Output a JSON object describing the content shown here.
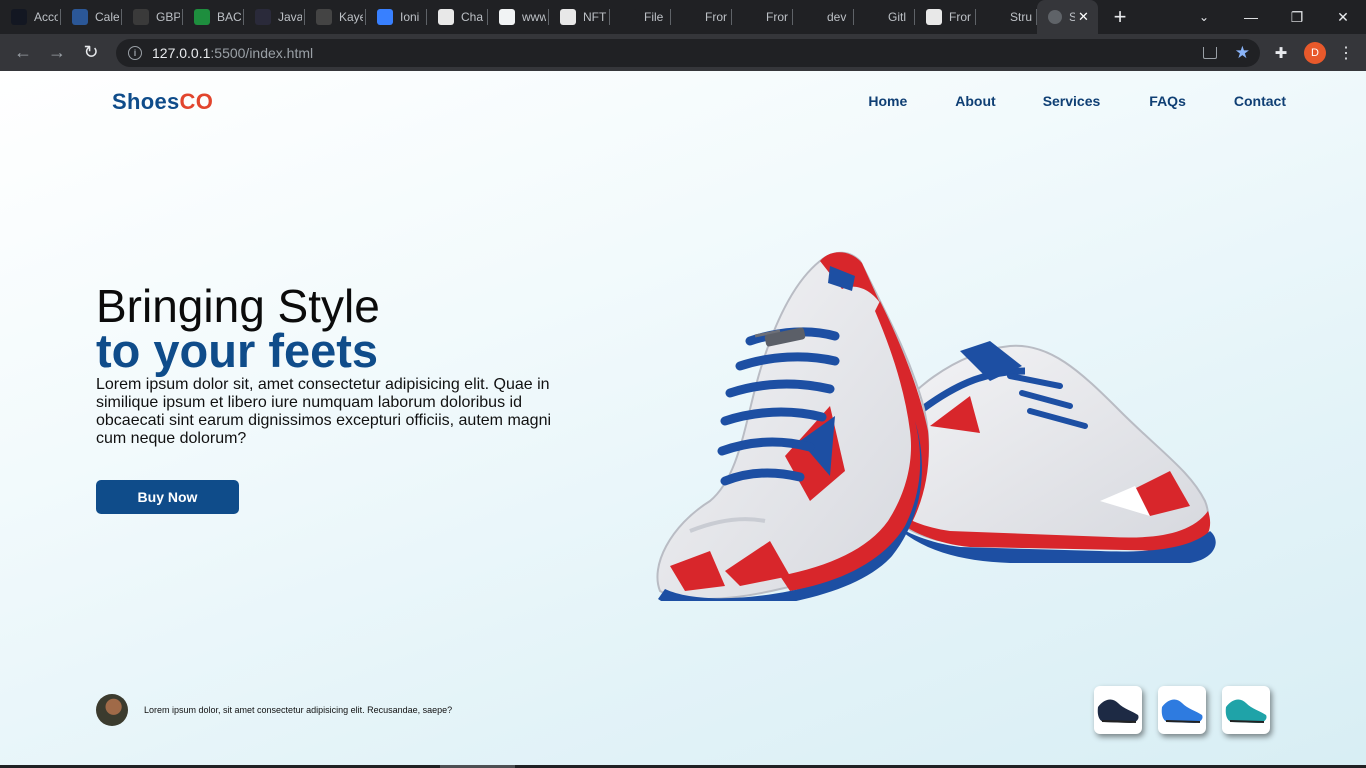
{
  "browser": {
    "tabs": [
      {
        "title": "Acco",
        "icon": "trading-icon",
        "color": "#131722"
      },
      {
        "title": "Cale",
        "icon": "calendar-icon",
        "color": "#2b5797"
      },
      {
        "title": "GBP",
        "icon": "function-icon",
        "color": "#3a3a3a"
      },
      {
        "title": "BAC",
        "icon": "sheets-icon",
        "color": "#1e8e3e"
      },
      {
        "title": "Java",
        "icon": "javascript-icon",
        "color": "#2a2a3a"
      },
      {
        "title": "Kaye",
        "icon": "qr-icon",
        "color": "#444"
      },
      {
        "title": "Ioni",
        "icon": "ionic-icon",
        "color": "#3880ff"
      },
      {
        "title": "Cha",
        "icon": "chat-icon",
        "color": "#e8e8e8"
      },
      {
        "title": "www",
        "icon": "doc-icon",
        "color": "#f1f3f4"
      },
      {
        "title": "NFT",
        "icon": "nft-icon",
        "color": "#e8e8e8"
      },
      {
        "title": "File",
        "icon": "github-icon",
        "color": "#202124"
      },
      {
        "title": "Fror",
        "icon": "github-icon",
        "color": "#202124"
      },
      {
        "title": "Fror",
        "icon": "github-icon",
        "color": "#202124"
      },
      {
        "title": "dev",
        "icon": "dev-icon",
        "color": "#202124"
      },
      {
        "title": "Gitl",
        "icon": "github-icon",
        "color": "#202124"
      },
      {
        "title": "Fror",
        "icon": "frontend-icon",
        "color": "#e8e8e8"
      },
      {
        "title": "Stru",
        "icon": "medium-icon",
        "color": "#202124"
      }
    ],
    "active_tab": {
      "title": "S",
      "icon": "globe-icon"
    },
    "url_host": "127.0.0.1",
    "url_path": ":5500/index.html",
    "profile_initial": "D"
  },
  "site": {
    "logo_part1": "Shoes",
    "logo_part2": "CO",
    "nav": {
      "home": "Home",
      "about": "About",
      "services": "Services",
      "faqs": "FAQs",
      "contact": "Contact"
    },
    "hero": {
      "title_line1": "Bringing Style",
      "title_line2": "to your feets",
      "description": "Lorem ipsum dolor sit, amet consectetur adipisicing elit. Quae in similique ipsum et libero iure numquam laborum doloribus id obcaecati sint earum dignissimos excepturi officiis, autem magni cum neque dolorum?",
      "cta": "Buy Now"
    },
    "review_text": "Lorem ipsum dolor, sit amet consectetur adipisicing elit. Recusandae, saepe?",
    "thumbnails": [
      {
        "name": "black-shoe-thumbnail",
        "color": "#1d2a44"
      },
      {
        "name": "blue-shoe-thumbnail",
        "color": "#2e7be0"
      },
      {
        "name": "teal-shoe-thumbnail",
        "color": "#1fa3a8"
      }
    ]
  }
}
